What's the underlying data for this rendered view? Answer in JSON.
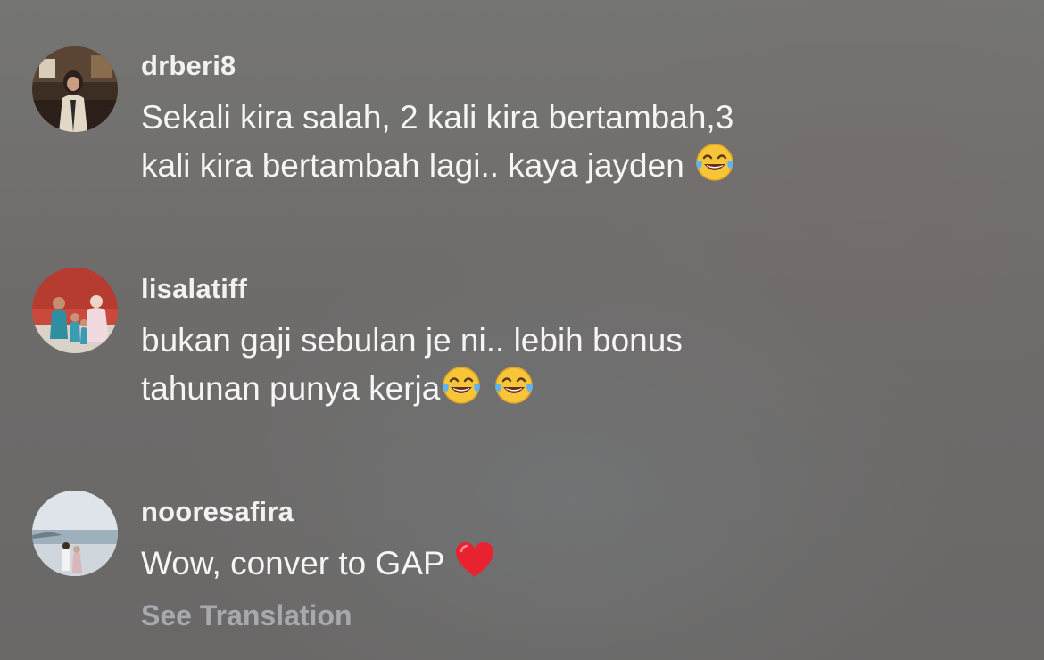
{
  "comments": [
    {
      "username": "drberi8",
      "lines": [
        "Sekali kira salah, 2 kali kira bertambah,3",
        "kali kira bertambah lagi.. kaya jayden"
      ],
      "emojis": [
        "face-with-tears-of-joy"
      ]
    },
    {
      "username": "lisalatiff",
      "lines": [
        "bukan gaji sebulan je ni.. lebih bonus",
        "tahunan punya kerja"
      ],
      "emojis": [
        "face-with-tears-of-joy",
        "face-with-tears-of-joy"
      ]
    },
    {
      "username": "nooresafira",
      "lines": [
        "Wow, conver to GAP"
      ],
      "emojis": [
        "red-heart"
      ],
      "see_translation": "See Translation"
    }
  ],
  "colors": {
    "username": "#f2f2f2",
    "text": "#f5f5f5",
    "see_translation": "#a7a9ae"
  }
}
